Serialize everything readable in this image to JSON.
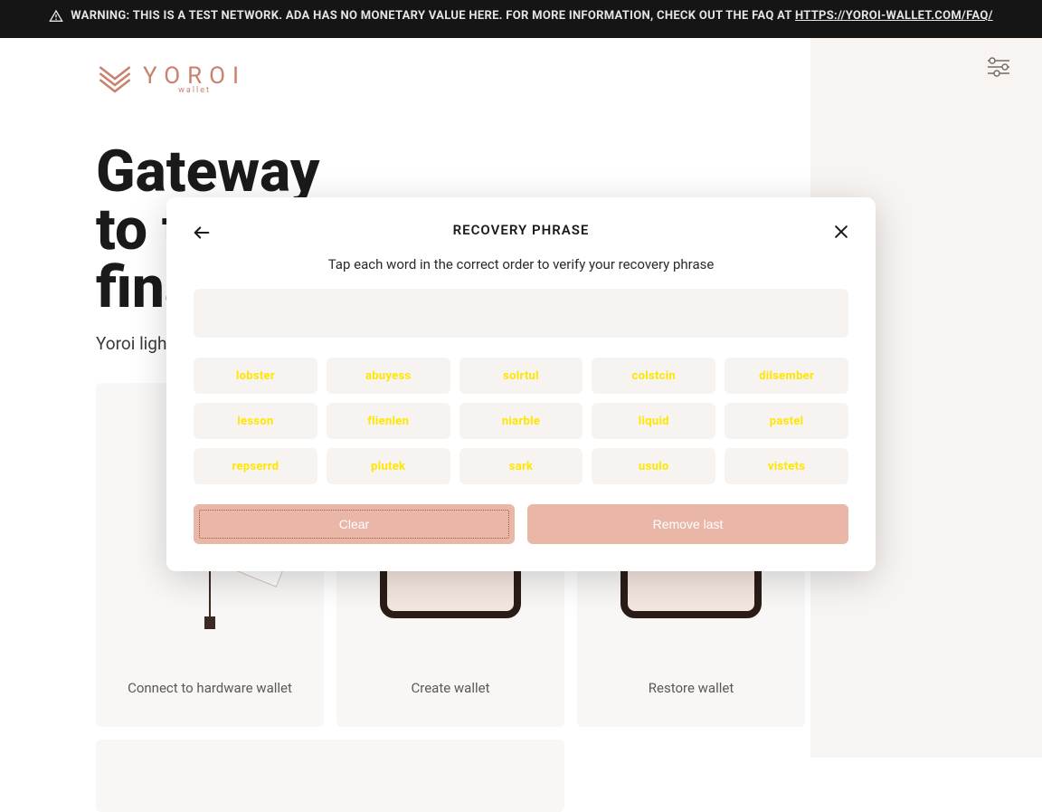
{
  "warning": {
    "prefix": "WARNING: THIS IS A TEST NETWORK. ADA HAS NO MONETARY VALUE HERE. FOR MORE INFORMATION, CHECK OUT THE FAQ AT ",
    "link_text": "HTTPS://YOROI-WALLET.COM/FAQ/"
  },
  "logo": {
    "name": "YOROI",
    "tagline": "wallet"
  },
  "hero": {
    "title_line1": "Gateway",
    "title_line2": "to the",
    "title_line3": "financial world",
    "subtitle": "Yoroi light wallet for Cardano assets"
  },
  "cards": {
    "hardware": "Connect to hardware wallet",
    "create": "Create wallet",
    "restore": "Restore wallet"
  },
  "modal": {
    "title": "RECOVERY PHRASE",
    "subtitle": "Tap each word in the correct order to verify your recovery phrase",
    "words": [
      "lobster",
      "abuyess",
      "solrtul",
      "colstcin",
      "dilsember",
      "lesson",
      "flienlen",
      "niarble",
      "liquid",
      "pastel",
      "repserrd",
      "plutek",
      "sark",
      "usulo",
      "vistets"
    ],
    "clear": "Clear",
    "remove_last": "Remove last"
  },
  "colors": {
    "accent": "#c8826d",
    "button_disabled": "#e9b6a8",
    "chip_bg": "#f7f3f1",
    "chip_text": "#ffe600"
  }
}
